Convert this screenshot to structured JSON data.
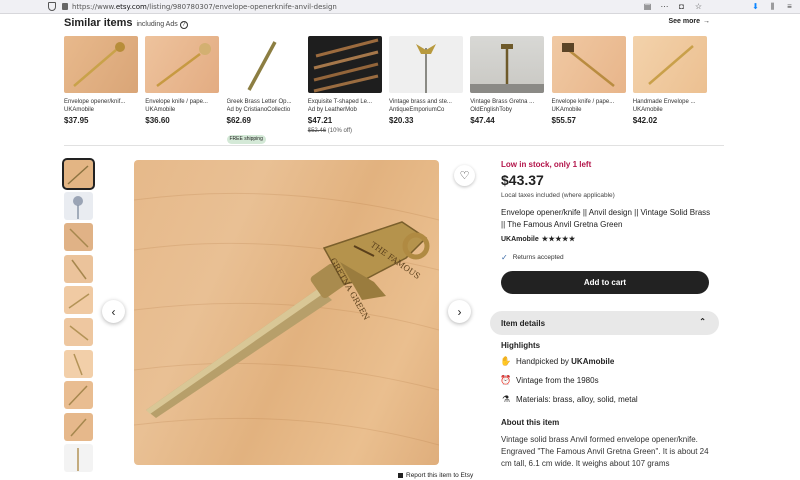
{
  "browser": {
    "url_prefix": "https://www.",
    "url_host": "etsy.com",
    "url_path": "/listing/980780307/envelope-openerknife-anvil-design"
  },
  "similar": {
    "title": "Similar items",
    "subtitle": "including Ads",
    "see_more": "See more",
    "items": [
      {
        "title": "Envelope opener/knif...",
        "shop": "UKAmobile",
        "price": "$37.95"
      },
      {
        "title": "Envelope knife / pape...",
        "shop": "UKAmobile",
        "price": "$36.60"
      },
      {
        "title": "Greek Brass Letter Op...",
        "shop": "Ad by CristianoCollectio",
        "price": "$62.69",
        "badge": "FREE shipping"
      },
      {
        "title": "Exquisite T-shaped Le...",
        "shop": "Ad by LeatherMob",
        "price": "$47.21",
        "original": "$52.46",
        "discount": "(10% off)"
      },
      {
        "title": "Vintage brass and ste...",
        "shop": "AntiqueEmporiumCo",
        "price": "$20.33"
      },
      {
        "title": "Vintage Brass Gretna ...",
        "shop": "OldEnglishToby",
        "price": "$47.44"
      },
      {
        "title": "Envelope knife / pape...",
        "shop": "UKAmobile",
        "price": "$55.57"
      },
      {
        "title": "Handmade Envelope ...",
        "shop": "UKAmobile",
        "price": "$42.02"
      }
    ]
  },
  "listing": {
    "stock": "Low in stock, only 1 left",
    "price": "$43.37",
    "tax": "Local taxes included (where applicable)",
    "title": "Envelope opener/knife || Anvil design || Vintage Solid Brass || The Famous Anvil Gretna Green",
    "shop": "UKAmobile",
    "rating": 5,
    "stars": "★★★★★",
    "returns": "Returns accepted",
    "add_to_cart": "Add to cart",
    "report": "Report this item to Etsy"
  },
  "details": {
    "bar_label": "Item details",
    "highlights_label": "Highlights",
    "handpicked_prefix": "Handpicked by ",
    "handpicked_shop": "UKAmobile",
    "vintage": "Vintage from the 1980s",
    "materials": "Materials: brass, alloy, solid, metal",
    "about_label": "About this item",
    "about_text": "Vintage solid brass Anvil formed envelope opener/knife. Engraved \"The Famous Anvil Gretna Green\". It is about 24 cm tall, 6.1 cm wide. It weighs about 107 grams"
  },
  "icons": {
    "shield": "shield-icon",
    "lock": "lock-icon",
    "heart": "heart-icon",
    "check": "check-icon",
    "chevron_up": "chevron-up-icon",
    "prev": "chevron-left-icon",
    "next": "chevron-right-icon"
  },
  "colors": {
    "stock": "#b3144a",
    "cart": "#222222",
    "details_bg": "#e8e8e8"
  }
}
